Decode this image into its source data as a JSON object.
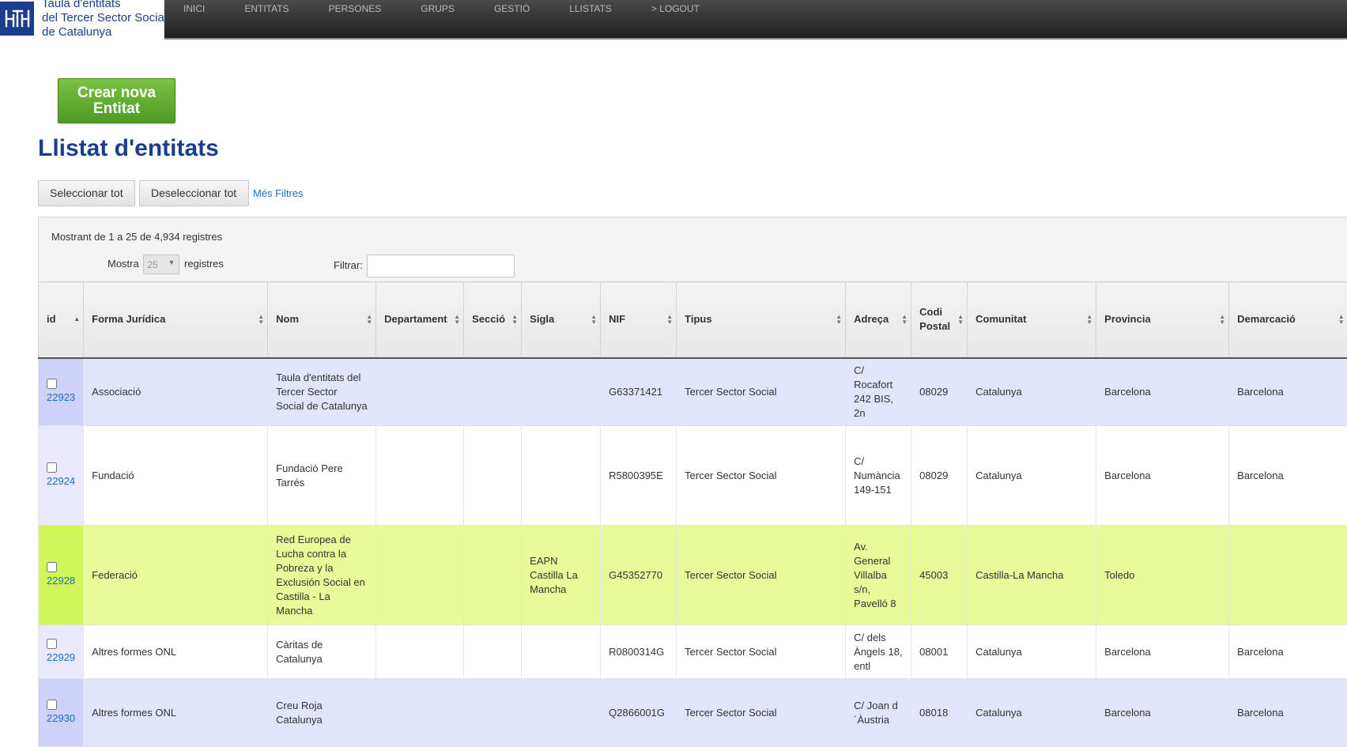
{
  "header": {
    "logo_lines": [
      "Taula d'entitats",
      "del Tercer Sector Social",
      "de Catalunya"
    ],
    "nav": [
      "INICI",
      "ENTITATS",
      "PERSONES",
      "GRUPS",
      "GESTIÓ",
      "LLISTATS",
      "> LOGOUT"
    ]
  },
  "create_button": {
    "line1": "Crear nova",
    "line2": "Entitat"
  },
  "title": "Llistat d'entitats",
  "toolbar": {
    "select_all": "Seleccionar tot",
    "deselect_all": "Deseleccionar tot",
    "more_filters": "Més Filtres"
  },
  "table_controls": {
    "info": "Mostrant de 1 a 25 de 4,934 registres",
    "show_label": "Mostra",
    "page_size": "25",
    "records_label": "registres",
    "filter_label": "Filtrar:",
    "filter_value": ""
  },
  "table": {
    "columns": [
      "id",
      "Forma Jurídica",
      "Nom",
      "Departament",
      "Secció",
      "Sigla",
      "NIF",
      "Tipus",
      "Adreça",
      "Codi Postal",
      "Comunitat",
      "Provincia",
      "Demarcació"
    ],
    "rows": [
      [
        "22923",
        "Associació",
        "Taula d'entitats del Tercer Sector Social de Catalunya",
        "",
        "",
        "",
        "G63371421",
        "Tercer Sector Social",
        "C/ Rocafort 242 BIS, 2n",
        "08029",
        "Catalunya",
        "Barcelona",
        "Barcelona"
      ],
      [
        "22924",
        "Fundació",
        "Fundació Pere Tarrés",
        "",
        "",
        "",
        "R5800395E",
        "Tercer Sector Social",
        "C/ Numància 149-151",
        "08029",
        "Catalunya",
        "Barcelona",
        "Barcelona"
      ],
      [
        "22928",
        "Federació",
        "Red Europea de Lucha contra la Pobreza y la Exclusión Social en Castilla - La Mancha",
        "",
        "",
        "EAPN Castilla La Mancha",
        "G45352770",
        "Tercer Sector Social",
        "Av. General Villalba s/n, Pavelló 8",
        "45003",
        "Castilla-La Mancha",
        "Toledo",
        ""
      ],
      [
        "22929",
        "Altres formes ONL",
        "Càritas de Catalunya",
        "",
        "",
        "",
        "R0800314G",
        "Tercer Sector Social",
        "C/ dels Àngels 18, entl",
        "08001",
        "Catalunya",
        "Barcelona",
        "Barcelona"
      ],
      [
        "22930",
        "Altres formes ONL",
        "Creu Roja Catalunya",
        "",
        "",
        "",
        "Q2866001G",
        "Tercer Sector Social",
        "C/ Joan d´Àustria",
        "08018",
        "Catalunya",
        "Barcelona",
        "Barcelona"
      ]
    ]
  }
}
